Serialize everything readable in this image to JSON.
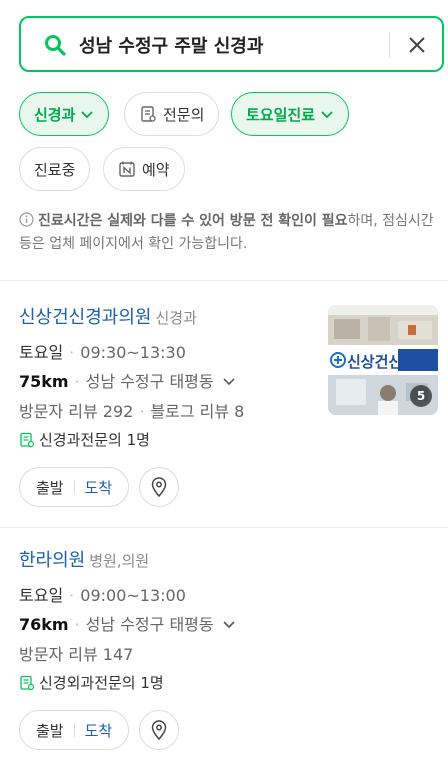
{
  "search": {
    "query": "성남 수정구 주말 신경과"
  },
  "filters": [
    {
      "label": "신경과",
      "active": true,
      "icon": "chevron-down-icon"
    },
    {
      "label": "전문의",
      "active": false,
      "icon": "doctor-list-icon"
    },
    {
      "label": "토요일진료",
      "active": true,
      "icon": "chevron-down-icon"
    },
    {
      "label": "진료중",
      "active": false
    },
    {
      "label": "예약",
      "active": false,
      "icon": "naver-booking-icon"
    }
  ],
  "notice": {
    "bold_text": "진료시간은 실제와 다를 수 있어 방문 전 확인이 필요",
    "rest_text": "하며, 점심시간 등은 업체 페이지에서 확인 가능합니다."
  },
  "results": [
    {
      "name": "신상건신경과의원",
      "category": "신경과",
      "day": "토요일",
      "hours": "09:30~13:30",
      "distance": "75km",
      "address": "성남 수정구 태평동",
      "review_visitor": "방문자 리뷰 292",
      "review_blog": "블로그 리뷰 8",
      "specialists": "신경과전문의 1명",
      "depart_label": "출발",
      "arrive_label": "도착",
      "thumb_count": "5",
      "thumb_sign": "신상건신경과"
    },
    {
      "name": "한라의원",
      "category": "병원,의원",
      "day": "토요일",
      "hours": "09:00~13:00",
      "distance": "76km",
      "address": "성남 수정구 태평동",
      "review_visitor": "방문자 리뷰 147",
      "specialists": "신경외과전문의 1명",
      "depart_label": "출발",
      "arrive_label": "도착"
    }
  ],
  "colors": {
    "accent": "#03c75a",
    "link": "#1a5fb4"
  }
}
